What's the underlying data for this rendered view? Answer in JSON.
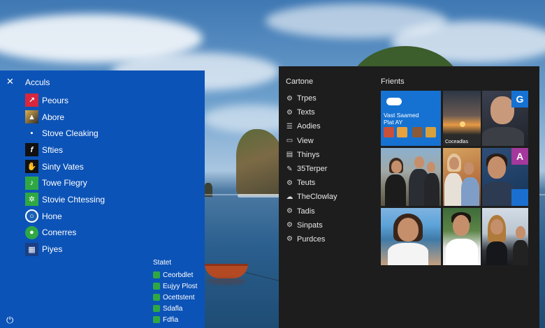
{
  "start_menu": {
    "title": "Acculs",
    "items": [
      {
        "label": "Peours",
        "icon": "red-app-icon",
        "color": "#d7263d"
      },
      {
        "label": "Abore",
        "icon": "photo-app-icon",
        "color": "#3a3a3a"
      },
      {
        "label": "Stove Cleaking",
        "icon": "window-app-icon",
        "color": "#2b7de0"
      },
      {
        "label": "Sfties",
        "icon": "f-letter-icon",
        "color": "#111111"
      },
      {
        "label": "Sinty Vates",
        "icon": "hand-icon",
        "color": "#111111"
      },
      {
        "label": "Towe Flegry",
        "icon": "green-leaf-icon",
        "color": "#2fa844"
      },
      {
        "label": "Stovie Chtessing",
        "icon": "green-network-icon",
        "color": "#2fa844"
      },
      {
        "label": "Hone",
        "icon": "home-circle-icon",
        "color": "#1a5fb4"
      },
      {
        "label": "Conerres",
        "icon": "green-chat-icon",
        "color": "#2fa844"
      },
      {
        "label": "Piyes",
        "icon": "grid-app-icon",
        "color": "#1a3f86"
      }
    ],
    "status_title": "Statet",
    "status_items": [
      {
        "label": "Ceorbdlet",
        "color": "#2fa844"
      },
      {
        "label": "Eujyy Plost",
        "color": "#2fa844"
      },
      {
        "label": "Ocettstent",
        "color": "#2fa844"
      },
      {
        "label": "Sdafla",
        "color": "#2fa844"
      },
      {
        "label": "Fdfia",
        "color": "#2fa844"
      }
    ]
  },
  "right_panel": {
    "header": "Cartone",
    "items": [
      {
        "label": "Trpes",
        "icon": "gear-icon"
      },
      {
        "label": "Texts",
        "icon": "gear-icon"
      },
      {
        "label": "Aodies",
        "icon": "list-icon"
      },
      {
        "label": "View",
        "icon": "monitor-icon"
      },
      {
        "label": "Thinys",
        "icon": "folder-icon"
      },
      {
        "label": "35Terper",
        "icon": "pen-icon"
      },
      {
        "label": "Teuts",
        "icon": "gear-icon"
      },
      {
        "label": "TheClowlay",
        "icon": "cloud-icon"
      },
      {
        "label": "Tadis",
        "icon": "gear-icon"
      },
      {
        "label": "Sinpats",
        "icon": "gear-icon"
      },
      {
        "label": "Purdces",
        "icon": "gear-icon"
      }
    ],
    "friends_header": "Frients",
    "tiles": {
      "onedrive_caption": "Vast Saamed Plat AY",
      "sunset_caption": "Coceadlas",
      "badge_g": "G",
      "badge_a": "A"
    }
  },
  "colors": {
    "start_blue": "#0c53b7",
    "panel_dark": "#1d1d1d",
    "tile_blue": "#1672d2",
    "tile_purple": "#a4389c"
  }
}
